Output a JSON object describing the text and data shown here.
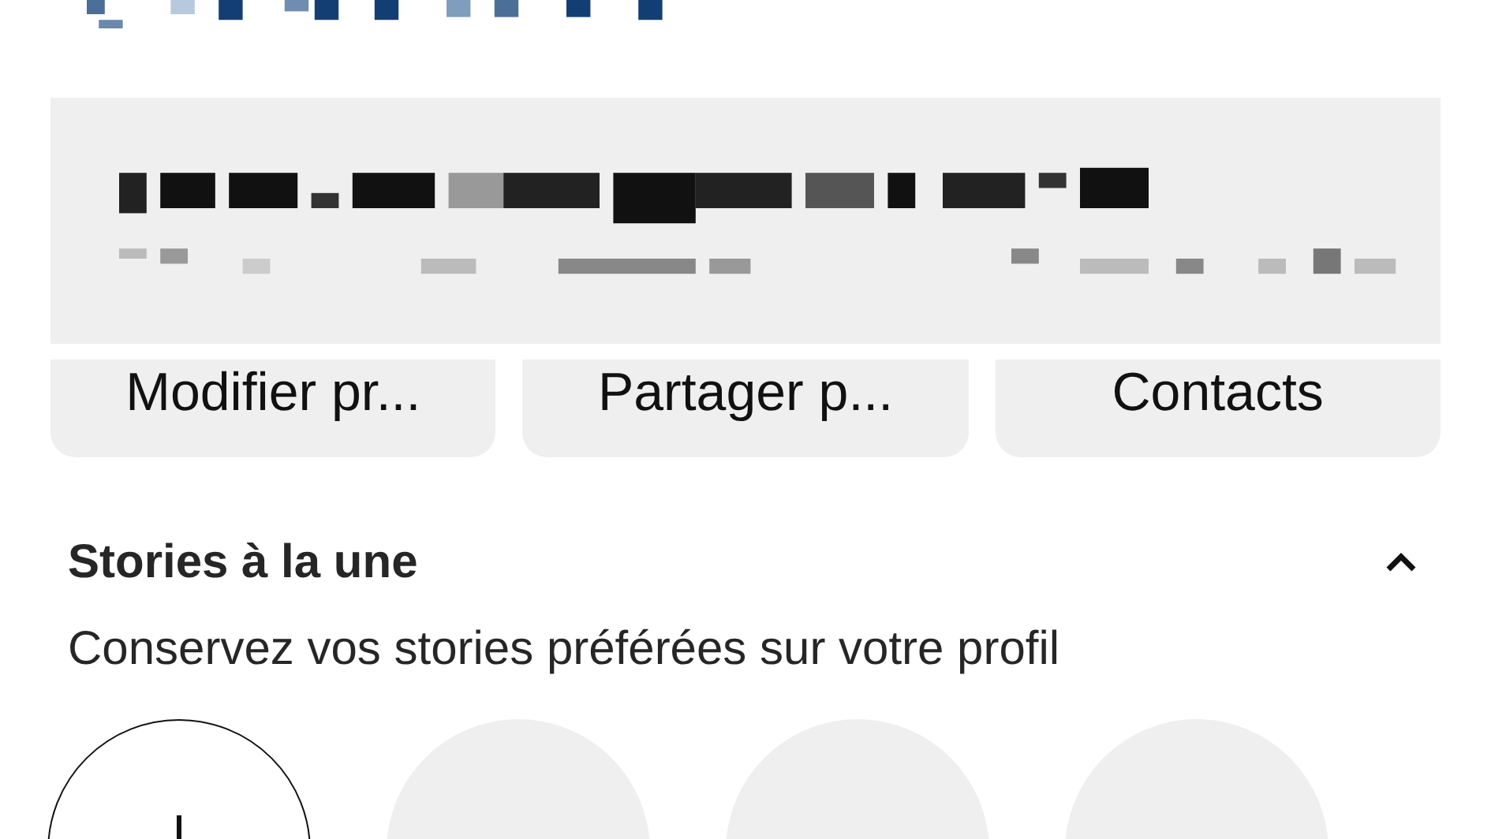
{
  "buttons": [
    {
      "label": "Modifier pr..."
    },
    {
      "label": "Partager p..."
    },
    {
      "label": "Contacts"
    }
  ],
  "highlights": {
    "title": "Stories à la une",
    "expanded": true,
    "subtitle": "Conservez vos stories préférées sur votre profil",
    "items": [
      {
        "kind": "new"
      },
      {
        "kind": "empty"
      },
      {
        "kind": "empty"
      },
      {
        "kind": "empty"
      }
    ]
  }
}
